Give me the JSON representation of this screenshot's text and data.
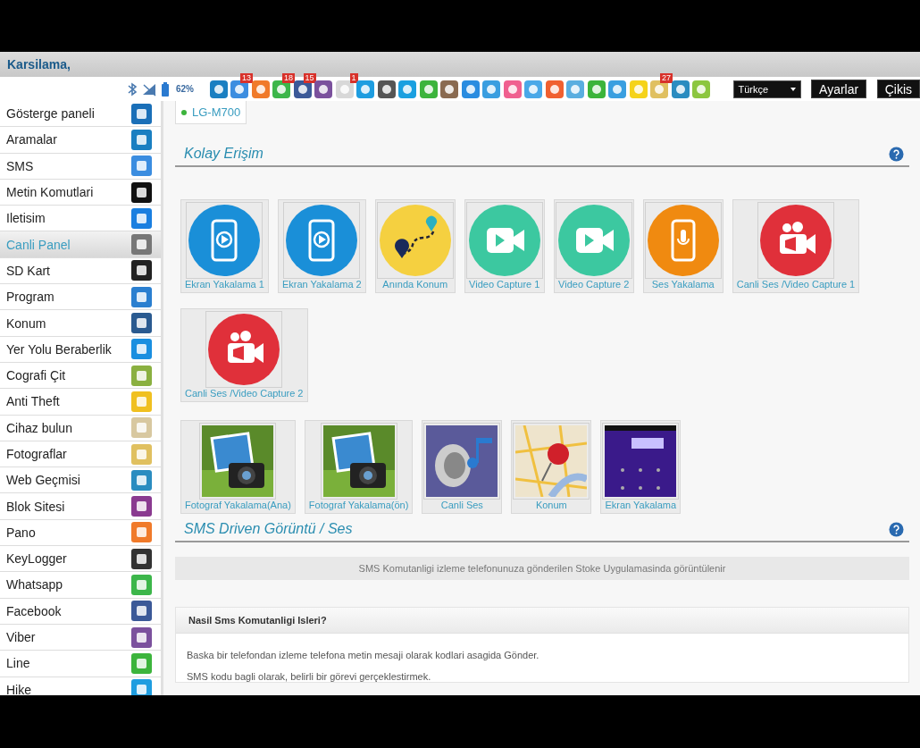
{
  "header": {
    "greeting": "Karsilama,"
  },
  "status": {
    "battery": "62%"
  },
  "toolbar_apps": [
    {
      "color": "#1a7fc1"
    },
    {
      "color": "#3b8de0",
      "badge": "13"
    },
    {
      "color": "#f07a2a"
    },
    {
      "color": "#3cb64a",
      "badge": "18"
    },
    {
      "color": "#3b5998",
      "badge": "15"
    },
    {
      "color": "#7b519d"
    },
    {
      "color": "#d8d8d8",
      "badge": "1"
    },
    {
      "color": "#1e9de0"
    },
    {
      "color": "#555555"
    },
    {
      "color": "#1aa0e0"
    },
    {
      "color": "#3cb43c"
    },
    {
      "color": "#8a6a50"
    },
    {
      "color": "#2a8ce0"
    },
    {
      "color": "#3a9ee0"
    },
    {
      "color": "#f06090"
    },
    {
      "color": "#4aa8e8"
    },
    {
      "color": "#f06030"
    },
    {
      "color": "#5aaee0"
    },
    {
      "color": "#3cb43b"
    },
    {
      "color": "#3a9fe0"
    },
    {
      "color": "#f5d31a"
    },
    {
      "color": "#e0c060",
      "badge": "27"
    },
    {
      "color": "#2a8cc0"
    },
    {
      "color": "#8cc63f"
    }
  ],
  "language_select": {
    "value": "Türkçe"
  },
  "buttons": [
    "Ayarlar",
    "Çikis"
  ],
  "sidebar": {
    "items": [
      {
        "label": "Gösterge paneli",
        "selected": false,
        "color": "#1a6fb8"
      },
      {
        "label": "Aramalar",
        "selected": false,
        "color": "#1a7fc1"
      },
      {
        "label": "SMS",
        "selected": false,
        "color": "#3b8de0"
      },
      {
        "label": "Metin Komutlari",
        "selected": false,
        "color": "#111111"
      },
      {
        "label": "Iletisim",
        "selected": false,
        "color": "#1a7fe0"
      },
      {
        "label": "Canli Panel",
        "selected": true,
        "color": "#777777"
      },
      {
        "label": "SD Kart",
        "selected": false,
        "color": "#222222"
      },
      {
        "label": "Program",
        "selected": false,
        "color": "#2a7fd0"
      },
      {
        "label": "Konum",
        "selected": false,
        "color": "#2a5a90"
      },
      {
        "label": "Yer Yolu Beraberlik",
        "selected": false,
        "color": "#1a8fe0"
      },
      {
        "label": "Cografi Çit",
        "selected": false,
        "color": "#8ab040"
      },
      {
        "label": "Anti Theft",
        "selected": false,
        "color": "#f0c020"
      },
      {
        "label": "Cihaz bulun",
        "selected": false,
        "color": "#d8c8a0"
      },
      {
        "label": "Fotograflar",
        "selected": false,
        "color": "#e0c060"
      },
      {
        "label": "Web Geçmisi",
        "selected": false,
        "color": "#2a8cc0"
      },
      {
        "label": "Blok Sitesi",
        "selected": false,
        "color": "#8a3a90"
      },
      {
        "label": "Pano",
        "selected": false,
        "color": "#f07a2a"
      },
      {
        "label": "KeyLogger",
        "selected": false,
        "color": "#333333"
      },
      {
        "label": "Whatsapp",
        "selected": false,
        "color": "#3cb64a"
      },
      {
        "label": "Facebook",
        "selected": false,
        "color": "#3b5998"
      },
      {
        "label": "Viber",
        "selected": false,
        "color": "#7b519d"
      },
      {
        "label": "Line",
        "selected": false,
        "color": "#3cb43c"
      },
      {
        "label": "Hike",
        "selected": false,
        "color": "#1e9de0"
      }
    ]
  },
  "device_tab": {
    "label": "LG-M700"
  },
  "quick_access": {
    "title": "Kolay Erişim",
    "tiles": [
      {
        "label": "Ekran Yakalama 1",
        "kind": "screen"
      },
      {
        "label": "Ekran Yakalama 2",
        "kind": "screen"
      },
      {
        "label": "Anında Konum",
        "kind": "location"
      },
      {
        "label": "Video Capture 1",
        "kind": "video"
      },
      {
        "label": "Video Capture 2",
        "kind": "video"
      },
      {
        "label": "Ses Yakalama",
        "kind": "audio"
      },
      {
        "label": "Canli Ses /Video Capture 1",
        "kind": "live"
      },
      {
        "label": "Canli Ses /Video Capture 2",
        "kind": "live"
      }
    ],
    "media_tiles": [
      {
        "label": "Fotograf Yakalama(Ana)"
      },
      {
        "label": "Fotograf Yakalama(ön)"
      },
      {
        "label": "Canli Ses",
        "kind": "sound"
      },
      {
        "label": "Konum",
        "kind": "map"
      },
      {
        "label": "Ekran Yakalama",
        "kind": "lock"
      }
    ]
  },
  "sms_section": {
    "title": "SMS Driven Görüntü / Ses",
    "notice": "SMS Komutanligi izleme telefonunuza gönderilen Stoke Uygulamasinda görüntülenir",
    "panel": {
      "title": "Nasil Sms Komutanligi Isleri?",
      "lines": [
        "Baska bir telefondan izleme telefona metin mesaji olarak kodlari asagida Gönder.",
        "SMS kodu bagli olarak, belirli bir görevi gerçeklestirmek."
      ]
    }
  }
}
